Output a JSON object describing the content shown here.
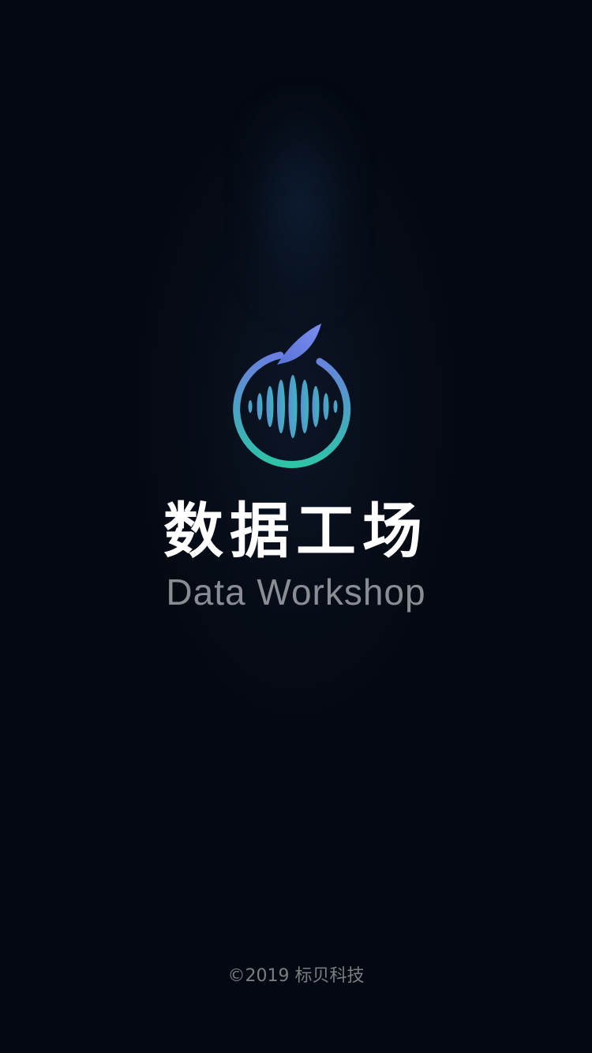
{
  "app": {
    "title_cn": "数据工场",
    "title_en": "Data Workshop",
    "logo_icon": "waveform-circle-logo"
  },
  "footer": {
    "copyright": "©2019 标贝科技"
  },
  "colors": {
    "background": "#050912",
    "logo_gradient_start": "#6a7fe0",
    "logo_gradient_end": "#2ec4a8",
    "title_cn": "#ffffff",
    "title_en": "#8a8d94",
    "footer": "#7a7d84"
  }
}
